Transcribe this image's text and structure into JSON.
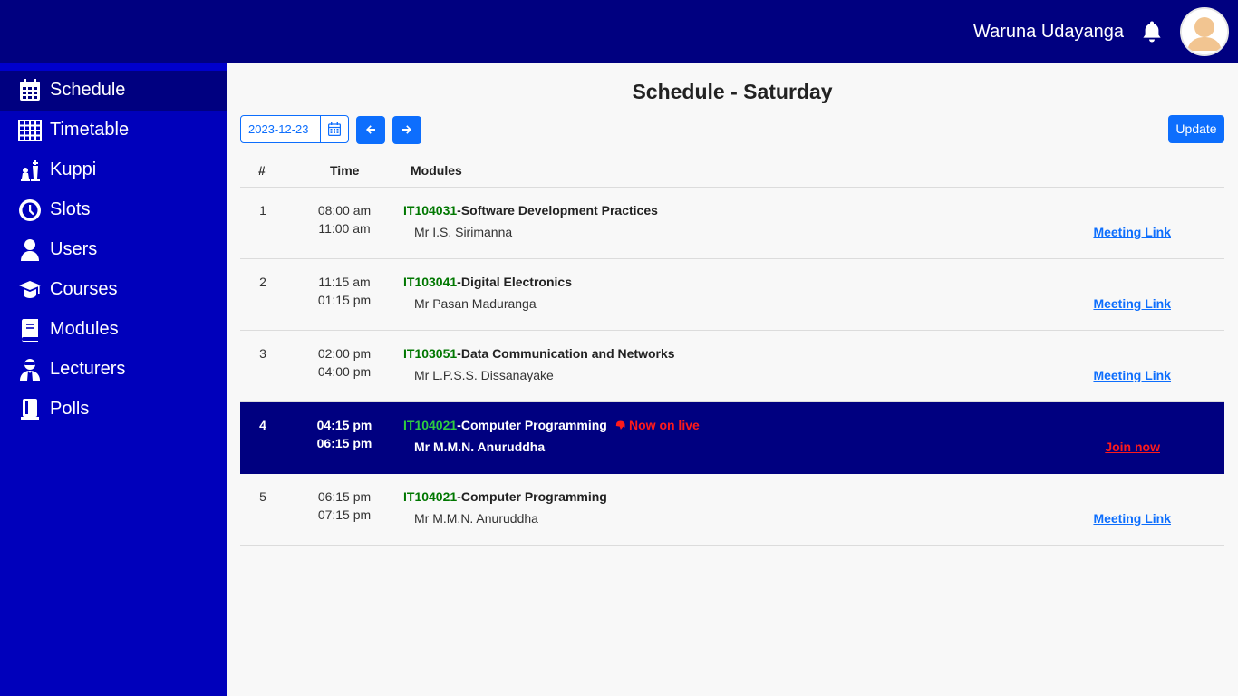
{
  "header": {
    "user_name": "Waruna Udayanga",
    "bell_icon": "bell-icon",
    "avatar_icon": "user-avatar-icon"
  },
  "sidebar": {
    "items": [
      {
        "label": "Schedule",
        "icon": "calendar-icon",
        "active": true
      },
      {
        "label": "Timetable",
        "icon": "grid-icon",
        "active": false
      },
      {
        "label": "Kuppi",
        "icon": "chess-icon",
        "active": false
      },
      {
        "label": "Slots",
        "icon": "clock-icon",
        "active": false
      },
      {
        "label": "Users",
        "icon": "user-icon",
        "active": false
      },
      {
        "label": "Courses",
        "icon": "graduation-cap-icon",
        "active": false
      },
      {
        "label": "Modules",
        "icon": "book-icon",
        "active": false
      },
      {
        "label": "Lecturers",
        "icon": "lecturer-icon",
        "active": false
      },
      {
        "label": "Polls",
        "icon": "poll-box-icon",
        "active": false
      }
    ]
  },
  "main": {
    "title": "Schedule - Saturday",
    "date_value": "2023-12-23",
    "update_label": "Update",
    "columns": [
      "#",
      "Time",
      "Modules"
    ],
    "rows": [
      {
        "num": "1",
        "start": "08:00 am",
        "end": "11:00 am",
        "code": "IT104031",
        "name": "-Software Development Practices",
        "lecturer": "Mr I.S. Sirimanna",
        "link": "Meeting Link"
      },
      {
        "num": "2",
        "start": "11:15 am",
        "end": "01:15 pm",
        "code": "IT103041",
        "name": "-Digital Electronics",
        "lecturer": "Mr Pasan Maduranga",
        "link": "Meeting Link"
      },
      {
        "num": "3",
        "start": "02:00 pm",
        "end": "04:00 pm",
        "code": "IT103051",
        "name": "-Data Communication and Networks",
        "lecturer": "Mr L.P.S.S. Dissanayake",
        "link": "Meeting Link"
      },
      {
        "num": "4",
        "start": "04:15 pm",
        "end": "06:15 pm",
        "code": "IT104021",
        "name": "-Computer Programming",
        "lecturer": "Mr M.M.N. Anuruddha",
        "link": "Join now",
        "live": "Now on live"
      },
      {
        "num": "5",
        "start": "06:15 pm",
        "end": "07:15 pm",
        "code": "IT104021",
        "name": "-Computer Programming",
        "lecturer": "Mr M.M.N. Anuruddha",
        "link": "Meeting Link"
      }
    ]
  },
  "colors": {
    "header_bg": "#000080",
    "sidebar_bg": "#0000bb",
    "accent": "#0d6efd",
    "code_green": "#007700",
    "live_red": "#ff1a1a"
  }
}
